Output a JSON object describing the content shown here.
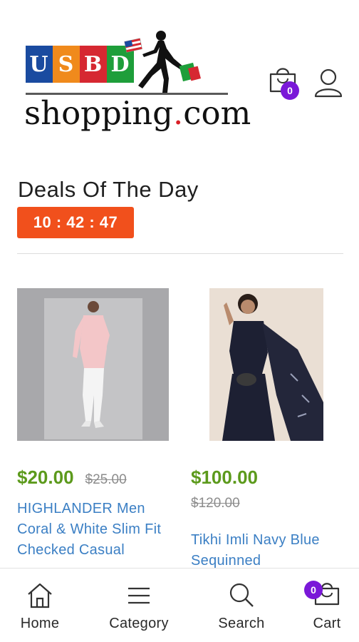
{
  "header": {
    "logo": {
      "letters": [
        "U",
        "S",
        "B",
        "D"
      ],
      "letter_colors": [
        "#1a4ba0",
        "#f08a1c",
        "#d62831",
        "#1e9e3a"
      ],
      "wordmark": "shopping",
      "wordmark_dot": ".",
      "wordmark_tld": "com"
    },
    "cart_icon": "shopping-bag-icon",
    "cart_count": "0",
    "user_icon": "user-icon",
    "badge_color": "#7a18d8"
  },
  "deals": {
    "title": "Deals Of The Day",
    "timer": "10 : 42 : 47",
    "timer_color": "#f1501c"
  },
  "products": [
    {
      "price": "$20.00",
      "old_price": "$25.00",
      "title": "HIGHLANDER Men Coral & White Slim Fit Checked Casual"
    },
    {
      "price": "$100.00",
      "old_price": "$120.00",
      "title": "Tikhi Imli Navy Blue Sequinned"
    }
  ],
  "bottom_nav": {
    "items": [
      {
        "label": "Home",
        "icon": "home-icon"
      },
      {
        "label": "Category",
        "icon": "menu-icon"
      },
      {
        "label": "Search",
        "icon": "search-icon"
      },
      {
        "label": "Cart",
        "icon": "shopping-bag-icon"
      }
    ],
    "cart_count": "0"
  },
  "colors": {
    "price": "#5c9a1c",
    "link": "#3b7fc4",
    "old_price": "#8c8c8c"
  }
}
